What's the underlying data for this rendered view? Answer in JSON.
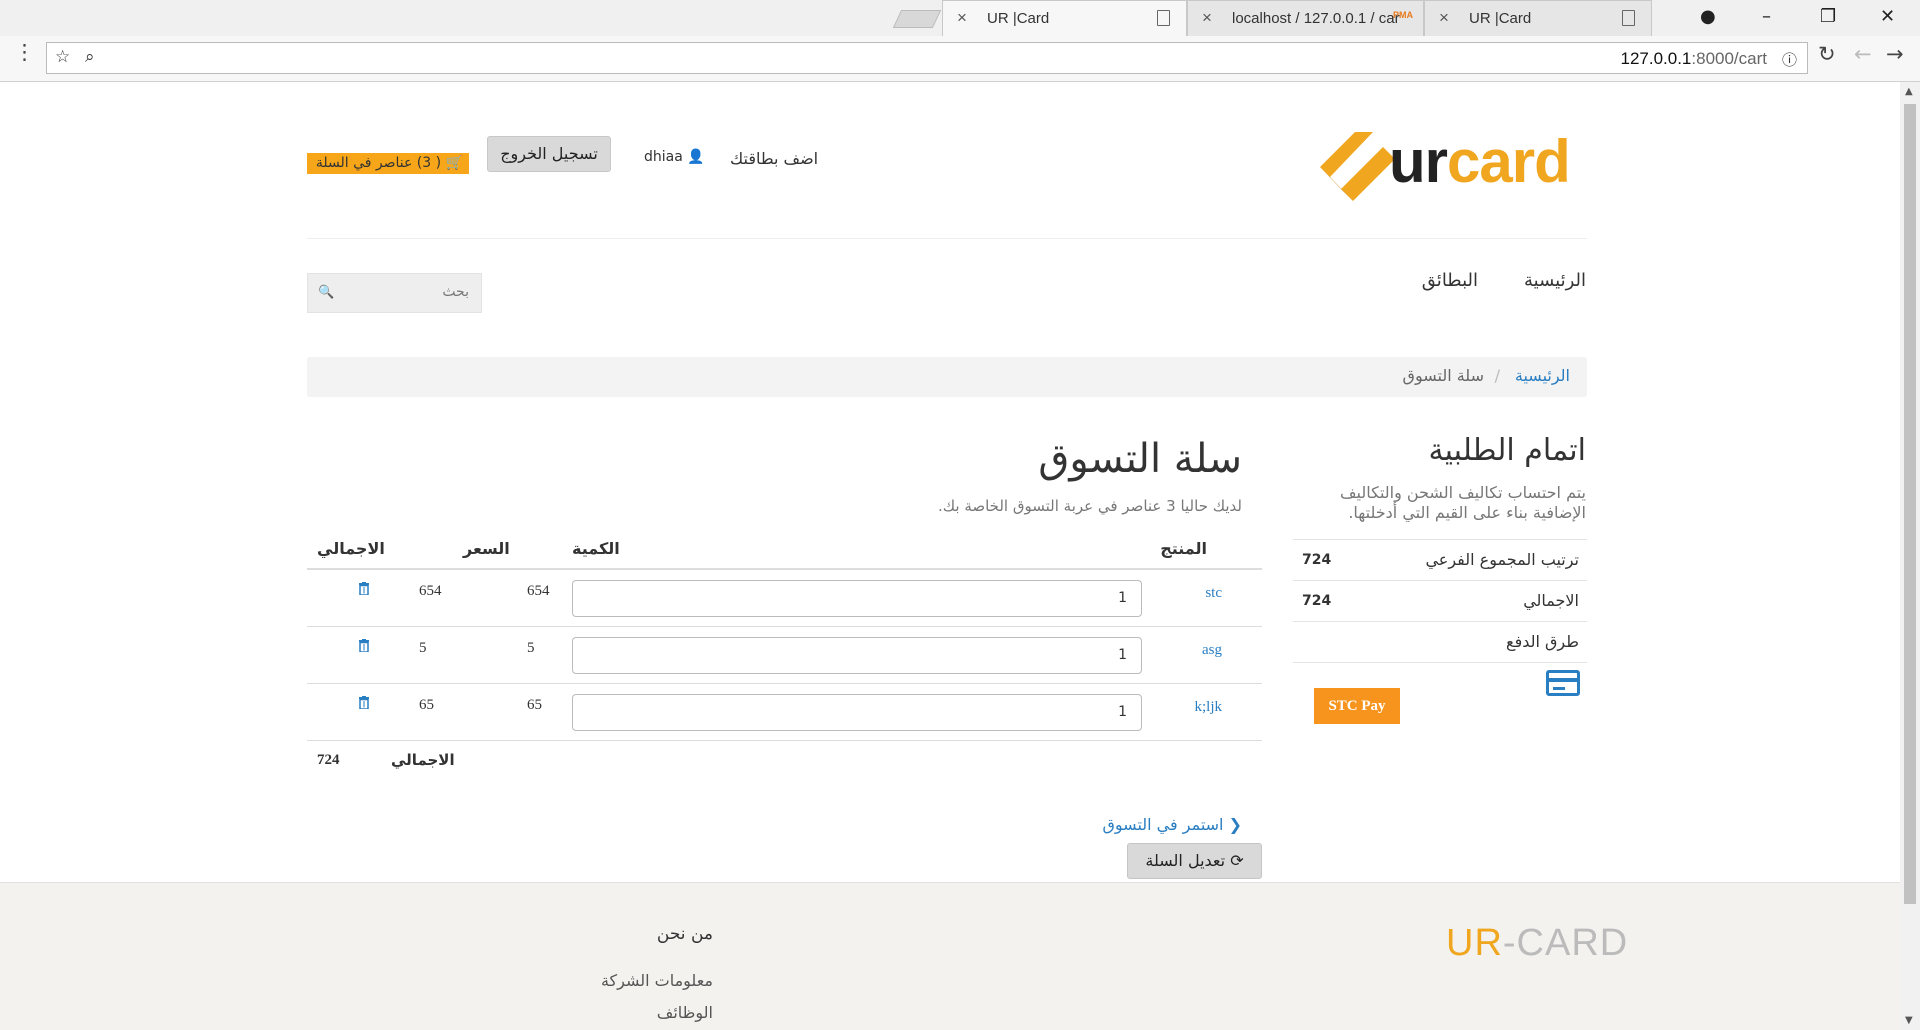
{
  "browser": {
    "tabs": [
      {
        "title": "UR |Card"
      },
      {
        "title": "localhost / 127.0.0.1 / car"
      },
      {
        "title": "UR |Card"
      }
    ],
    "url_host": "127.0.0.1",
    "url_path": ":8000/cart"
  },
  "header": {
    "logo_u": "ur",
    "logo_card": "card",
    "add_card": "اضف بطاقتك",
    "username": "dhiaa",
    "logout": "تسجيل الخروج",
    "cart_link": "( 3) عناصر في السلة"
  },
  "nav": {
    "home": "الرئيسية",
    "cards": "البطائق",
    "search_placeholder": "بحث"
  },
  "breadcrumb": {
    "home": "الرئيسية",
    "separator": "/",
    "current": "سلة التسوق"
  },
  "order": {
    "title": "اتمام الطلبية",
    "description": "يتم احتساب تكاليف الشحن والتكاليف الإضافية بناء على القيم التي أدخلتها.",
    "subtotal_label": "ترتيب المجموع الفرعي",
    "subtotal_value": "724",
    "total_label": "الاجمالي",
    "total_value": "724",
    "payment_methods_label": "طرق الدفع",
    "stc_pay": "STC Pay"
  },
  "cart": {
    "title": "سلة التسوق",
    "description": "لديك حاليا 3 عناصر في عربة التسوق الخاصة بك.",
    "columns": {
      "product": "المنتج",
      "quantity": "الكمية",
      "price": "السعر",
      "total": "الاجمالي"
    },
    "rows": [
      {
        "product": "stc",
        "quantity": "1",
        "price": "654",
        "total": "654"
      },
      {
        "product": "asg",
        "quantity": "1",
        "price": "5",
        "total": "5"
      },
      {
        "product": "k;ljk",
        "quantity": "1",
        "price": "65",
        "total": "65"
      }
    ],
    "sum_label": "الاجمالي",
    "sum_value": "724",
    "continue_shopping": "استمر في التسوق",
    "update_cart": "تعديل السلة"
  },
  "footer": {
    "logo_ur": "UR",
    "logo_rest": "-CARD",
    "about_heading": "من نحن",
    "company_info": "معلومات الشركة",
    "jobs": "الوظائف"
  },
  "colors": {
    "accent_orange": "#f7a619",
    "link_blue": "#2a7ec2"
  }
}
